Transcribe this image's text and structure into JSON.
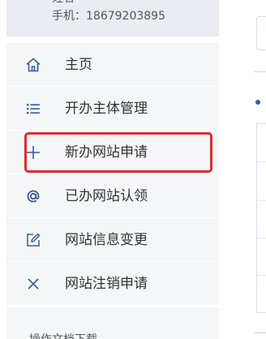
{
  "user": {
    "name": "姓名",
    "phone": "手机：18679203895"
  },
  "sidebar": {
    "items": [
      {
        "label": "主页",
        "icon": "home-icon"
      },
      {
        "label": "开办主体管理",
        "icon": "list-icon"
      },
      {
        "label": "新办网站申请",
        "icon": "plus-icon"
      },
      {
        "label": "已办网站认领",
        "icon": "at-icon"
      },
      {
        "label": "网站信息变更",
        "icon": "edit-icon"
      },
      {
        "label": "网站注销申请",
        "icon": "close-icon"
      }
    ],
    "next_section_label": "操作文档下载"
  },
  "colors": {
    "icon": "#3a5a9b",
    "highlight_border": "#e5282e",
    "sidebar_bg": "#f5f6f8",
    "user_card_bg": "#e9ecf1"
  }
}
